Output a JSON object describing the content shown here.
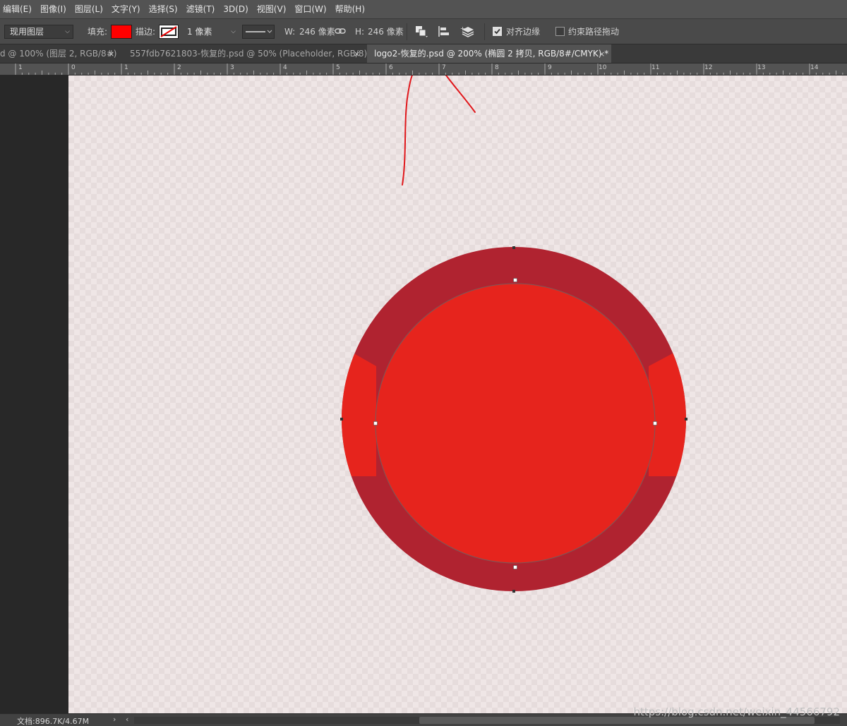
{
  "menu": {
    "items": [
      "编辑(E)",
      "图像(I)",
      "图层(L)",
      "文字(Y)",
      "选择(S)",
      "滤镜(T)",
      "3D(D)",
      "视图(V)",
      "窗口(W)",
      "帮助(H)"
    ]
  },
  "options": {
    "layer_mode": "现用图层",
    "fill_label": "填充:",
    "fill_color": "#ff0000",
    "stroke_label": "描边:",
    "stroke_width": "1 像素",
    "w_label": "W:",
    "w_value": "246 像素",
    "h_label": "H:",
    "h_value": "246 像素",
    "align_edges_label": "对齐边缘",
    "align_edges_checked": true,
    "constrain_path_label": "约束路径拖动",
    "constrain_path_checked": false
  },
  "tabs": [
    {
      "title": "d @ 100% (图层 2, RGB/8#)",
      "active": false,
      "close": "×"
    },
    {
      "title": "557fdb7621803-恢复的.psd @ 50% (Placeholder, RGB/8) *",
      "active": false,
      "close": "×"
    },
    {
      "title": "logo2-恢复的.psd @ 200% (椭圆 2 拷贝, RGB/8#/CMYK) *",
      "active": true,
      "close": "×"
    }
  ],
  "ruler": {
    "labels": [
      "1",
      "0",
      "1",
      "2",
      "3",
      "4",
      "5",
      "6",
      "7",
      "8",
      "9",
      "10",
      "11",
      "12",
      "13",
      "14"
    ]
  },
  "shape": {
    "outer_color": "#b02330",
    "inner_color": "#e6241d",
    "ring_highlight_color": "#e6241d"
  },
  "status": {
    "doc_info": "文档:896.7K/4.67M",
    "arrow_right": "›",
    "arrow_left": "‹"
  },
  "watermark": "https://blog.csdn.net/weixin_44566792"
}
